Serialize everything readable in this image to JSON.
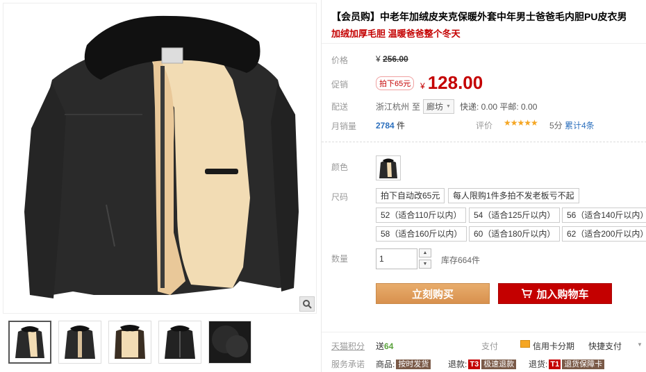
{
  "product": {
    "title": "【会员购】中老年加绒皮夹克保暖外套中年男士爸爸毛内胆PU皮衣男",
    "subtitle": "加绒加厚毛胆 温暖爸爸整个冬天"
  },
  "price": {
    "label": "价格",
    "currency": "¥",
    "original": "256.00"
  },
  "promo": {
    "label": "促销",
    "badge": "拍下65元",
    "currency": "¥",
    "price": "128.00"
  },
  "shipping": {
    "label": "配送",
    "from": "浙江杭州",
    "to_word": "至",
    "destination": "廊坊",
    "fees": "快递: 0.00 平邮: 0.00"
  },
  "sales": {
    "label": "月销量",
    "count": "2784",
    "unit": "件"
  },
  "rating": {
    "label": "评价",
    "stars": "★★★★★",
    "score": "5分",
    "total": "累计4条"
  },
  "color": {
    "label": "颜色"
  },
  "size": {
    "label": "尺码",
    "notes": [
      "拍下自动改65元",
      "每人限购1件多拍不发老板亏不起"
    ],
    "options": [
      "52（适合110斤以内）",
      "54（适合125斤以内）",
      "56（适合140斤以内）",
      "58（适合160斤以内）",
      "60（适合180斤以内）",
      "62（适合200斤以内）"
    ]
  },
  "quantity": {
    "label": "数量",
    "value": "1",
    "stock": "库存664件"
  },
  "actions": {
    "buy_now": "立刻购买",
    "add_to_cart": "加入购物车"
  },
  "points": {
    "label": "天猫积分",
    "prefix": "送",
    "value": "64"
  },
  "payment": {
    "label": "支付",
    "credit": "信用卡分期",
    "quick": "快捷支付"
  },
  "service": {
    "label": "服务承诺",
    "goods_label": "商品:",
    "goods_tag": "按时发货",
    "refund_label": "退款:",
    "refund_badge": "T3",
    "refund_tag": "极速退款",
    "return_label": "退货:",
    "return_badge": "T1",
    "return_tag": "退货保障卡"
  },
  "colors": {
    "price_red": "#c40000",
    "buy_orange": "#d8914e",
    "link_blue": "#2b6fbd"
  },
  "icons": {
    "zoom": "magnifier-icon",
    "cart": "cart-icon",
    "stars": "star-icon",
    "credit": "credit-card-icon"
  }
}
